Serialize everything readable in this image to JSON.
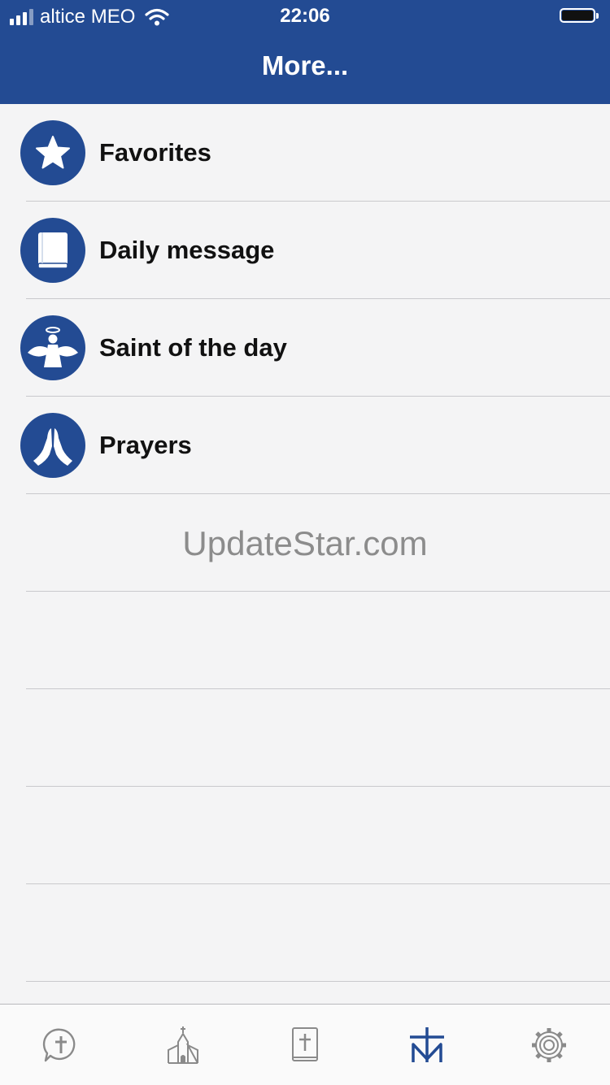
{
  "status": {
    "carrier": "altice MEO",
    "time": "22:06"
  },
  "header": {
    "title": "More..."
  },
  "menu": {
    "items": [
      {
        "label": "Favorites",
        "icon": "star-icon"
      },
      {
        "label": "Daily message",
        "icon": "book-icon"
      },
      {
        "label": "Saint of the day",
        "icon": "angel-icon"
      },
      {
        "label": "Prayers",
        "icon": "praying-hands-icon"
      }
    ]
  },
  "watermark": "UpdateStar.com",
  "tabbar": {
    "tabs": [
      {
        "icon": "cross-chat-icon",
        "active": false
      },
      {
        "icon": "church-icon",
        "active": false
      },
      {
        "icon": "bible-icon",
        "active": false
      },
      {
        "icon": "cross-m-icon",
        "active": true
      },
      {
        "icon": "settings-gear-icon",
        "active": false
      }
    ]
  },
  "colors": {
    "brand": "#234b93",
    "inactive_tab": "#8a8a8a",
    "background": "#f4f4f5"
  }
}
